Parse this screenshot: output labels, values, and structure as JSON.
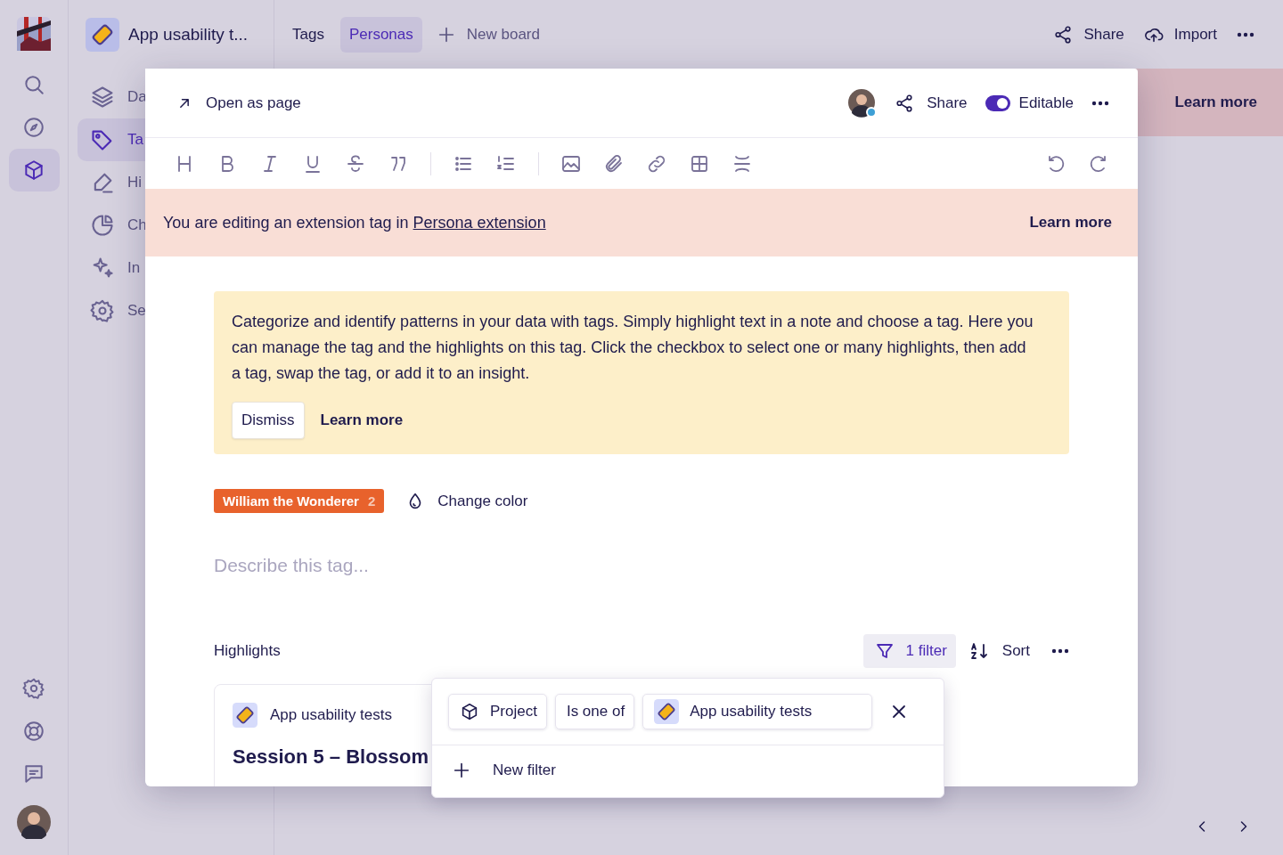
{
  "rail_items": [
    {
      "selected": false
    },
    {
      "selected": false
    },
    {
      "selected": true
    }
  ],
  "project": {
    "name": "App usability t..."
  },
  "board_tabs": [
    {
      "label": "Tags",
      "selected": false
    },
    {
      "label": "Personas",
      "selected": true
    }
  ],
  "new_board": "New board",
  "top_actions": {
    "share": "Share",
    "import": "Import"
  },
  "nav_items": [
    {
      "label": "Da",
      "selected": false
    },
    {
      "label": "Ta",
      "selected": true
    },
    {
      "label": "Hi",
      "selected": false
    },
    {
      "label": "Ch",
      "selected": false
    },
    {
      "label": "In",
      "selected": false
    },
    {
      "label": "Se",
      "selected": false
    }
  ],
  "background_banner": {
    "action": "Learn more"
  },
  "modal": {
    "open_as_page": "Open as page",
    "share": "Share",
    "editable": {
      "label": "Editable",
      "on": true
    },
    "banner": {
      "text": "You are editing an extension tag in ",
      "link": "Persona extension",
      "action": "Learn more"
    },
    "info": {
      "text": "Categorize and identify patterns in your data with tags. Simply highlight text in a note and choose a tag. Here you can manage the tag and the highlights on this tag. Click the checkbox to select one or many highlights, then add a tag, swap the tag, or add it to an insight.",
      "dismiss": "Dismiss",
      "learn_more": "Learn more"
    },
    "tag": {
      "name": "William the Wonderer",
      "count": "2",
      "color": "#e8622c"
    },
    "change_color": "Change color",
    "description": {
      "placeholder": "Describe this tag..."
    },
    "highlights": {
      "title": "Highlights",
      "filter": "1 filter",
      "sort": "Sort"
    },
    "card": {
      "project": "App usability tests",
      "title": "Session 5 – Blossom"
    }
  },
  "filter_popover": {
    "chips": [
      "Project",
      "Is one of",
      "App usability tests"
    ],
    "new_filter": "New filter"
  }
}
